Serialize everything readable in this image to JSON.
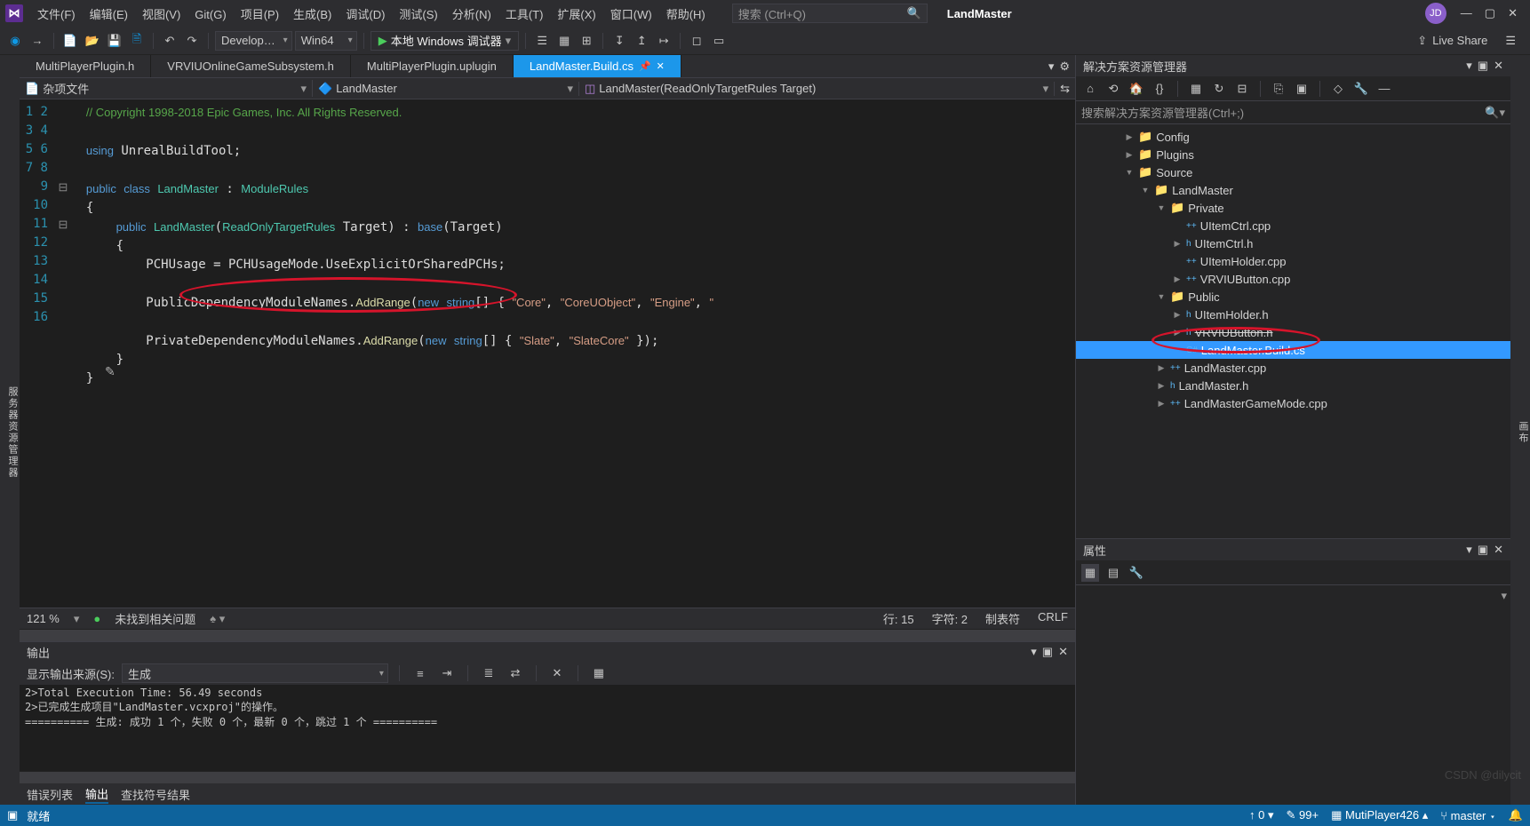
{
  "menu": [
    "文件(F)",
    "编辑(E)",
    "视图(V)",
    "Git(G)",
    "项目(P)",
    "生成(B)",
    "调试(D)",
    "测试(S)",
    "分析(N)",
    "工具(T)",
    "扩展(X)",
    "窗口(W)",
    "帮助(H)"
  ],
  "search_placeholder": "搜索 (Ctrl+Q)",
  "app_title": "LandMaster",
  "user_initials": "JD",
  "toolbar": {
    "config": "Develop…",
    "platform": "Win64",
    "run": "本地 Windows 调试器",
    "live_share": "Live Share"
  },
  "side_left": "服务器资源管理器",
  "side_right": "画布",
  "tabs": [
    {
      "label": "MultiPlayerPlugin.h",
      "active": false
    },
    {
      "label": "VRVIUOnlineGameSubsystem.h",
      "active": false
    },
    {
      "label": "MultiPlayerPlugin.uplugin",
      "active": false
    },
    {
      "label": "LandMaster.Build.cs",
      "active": true
    }
  ],
  "breadcrumb": {
    "a": "杂项文件",
    "b": "LandMaster",
    "c": "LandMaster(ReadOnlyTargetRules Target)"
  },
  "code_lines": 16,
  "editor_status": {
    "zoom": "121 %",
    "issues": "未找到相关问题",
    "line": "行: 15",
    "col": "字符: 2",
    "ins": "制表符",
    "eol": "CRLF"
  },
  "output": {
    "title": "输出",
    "source_label": "显示输出来源(S):",
    "source": "生成",
    "lines": [
      "2>Total Execution Time: 56.49 seconds",
      "2>已完成生成项目\"LandMaster.vcxproj\"的操作。",
      "========== 生成: 成功 1 个，失败 0 个，最新 0 个，跳过 1 个 =========="
    ]
  },
  "bottom_tabs": [
    "错误列表",
    "输出",
    "查找符号结果"
  ],
  "status": {
    "ready": "就绪",
    "watermark": "CSDN @dilycit",
    "errors": "0",
    "warnings": "99+",
    "repo": "MutiPlayer426",
    "branch": "master"
  },
  "solution": {
    "title": "解决方案资源管理器",
    "search": "搜索解决方案资源管理器(Ctrl+;)",
    "tree": [
      {
        "indent": 3,
        "arrow": "▶",
        "icon": "folder",
        "label": "Config"
      },
      {
        "indent": 3,
        "arrow": "▶",
        "icon": "folder",
        "label": "Plugins"
      },
      {
        "indent": 3,
        "arrow": "▼",
        "icon": "folder",
        "label": "Source"
      },
      {
        "indent": 4,
        "arrow": "▼",
        "icon": "folder",
        "label": "LandMaster"
      },
      {
        "indent": 5,
        "arrow": "▼",
        "icon": "folder",
        "label": "Private"
      },
      {
        "indent": 6,
        "arrow": "",
        "icon": "cpp",
        "label": "UItemCtrl.cpp"
      },
      {
        "indent": 6,
        "arrow": "▶",
        "icon": "h",
        "label": "UItemCtrl.h"
      },
      {
        "indent": 6,
        "arrow": "",
        "icon": "cpp",
        "label": "UItemHolder.cpp"
      },
      {
        "indent": 6,
        "arrow": "▶",
        "icon": "cpp",
        "label": "VRVIUButton.cpp"
      },
      {
        "indent": 5,
        "arrow": "▼",
        "icon": "folder",
        "label": "Public"
      },
      {
        "indent": 6,
        "arrow": "▶",
        "icon": "h",
        "label": "UItemHolder.h"
      },
      {
        "indent": 6,
        "arrow": "▶",
        "icon": "h",
        "label": "VRVIUButton.h",
        "strike": true
      },
      {
        "indent": 6,
        "arrow": "",
        "icon": "cs",
        "label": "LandMaster.Build.cs",
        "sel": true
      },
      {
        "indent": 5,
        "arrow": "▶",
        "icon": "cpp",
        "label": "LandMaster.cpp"
      },
      {
        "indent": 5,
        "arrow": "▶",
        "icon": "h",
        "label": "LandMaster.h"
      },
      {
        "indent": 5,
        "arrow": "▶",
        "icon": "cpp",
        "label": "LandMasterGameMode.cpp"
      }
    ]
  },
  "props": {
    "title": "属性"
  }
}
